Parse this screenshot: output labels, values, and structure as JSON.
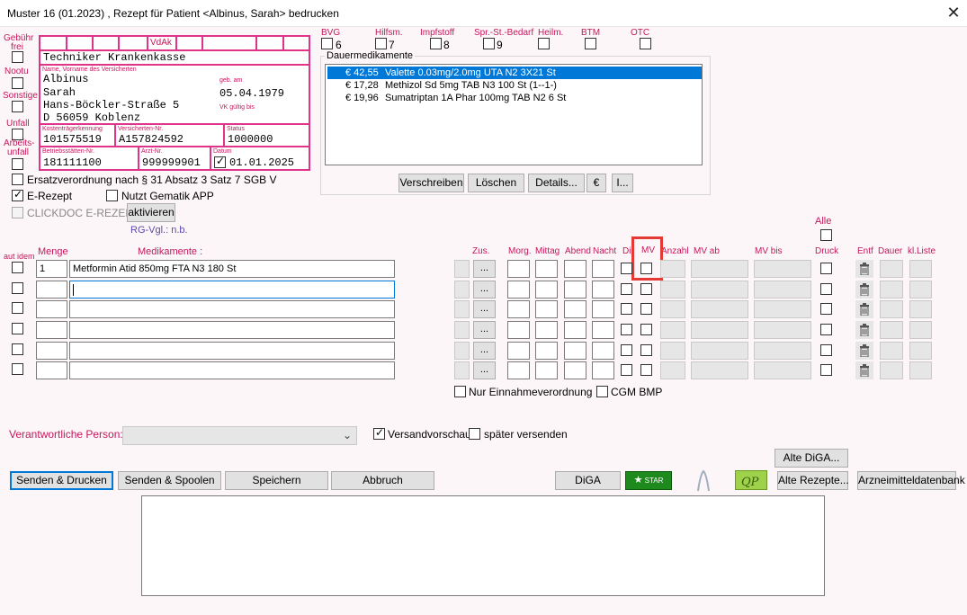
{
  "window": {
    "title": "Muster 16 (01.2023) , Rezept für Patient <Albinus, Sarah> bedrucken",
    "close_glyph": "✕"
  },
  "left_flags": [
    {
      "label": "Gebühr frei",
      "checked": false
    },
    {
      "label": "Nootu",
      "checked": false
    },
    {
      "label": "Sonstige",
      "checked": false
    },
    {
      "label": "Unfall",
      "checked": false
    },
    {
      "label": "Arbeits-unfall",
      "checked": false
    }
  ],
  "form": {
    "vdak_label": "VdAk",
    "kasse": "Techniker Krankenkasse",
    "name_label": "Name, Vorname des Versicherten",
    "last_name": "Albinus",
    "first_name": "Sarah",
    "street": "Hans-Böckler-Straße 5",
    "city": "D 56059 Koblenz",
    "geb_label": "geb. am",
    "birth_date": "05.04.1979",
    "vk_label": "VK gültig bis",
    "kostentraeger_label": "Kostenträgerkennung",
    "kostentraeger": "101575519",
    "versicherten_label": "Versicherten-Nr.",
    "versicherten_nr": "A157824592",
    "status_label": "Status",
    "status": "1000000",
    "betrieb_label": "Betriebsstätten-Nr.",
    "betrieb_nr": "181111100",
    "arzt_label": "Arzt-Nr.",
    "arzt_nr": "999999901",
    "datum_label": "Datum",
    "datum": "01.01.2025"
  },
  "top_flags": [
    {
      "label": "BVG",
      "num": "6"
    },
    {
      "label": "Hilfsm.",
      "num": "7"
    },
    {
      "label": "Impfstoff",
      "num": "8"
    },
    {
      "label": "Spr.-St.-Bedarf",
      "num": "9"
    },
    {
      "label": "Heilm.",
      "num": ""
    },
    {
      "label": "BTM",
      "num": ""
    },
    {
      "label": "OTC",
      "num": ""
    }
  ],
  "dauer": {
    "label": "Dauermedikamente",
    "items": [
      {
        "price": "€ 42,55",
        "name": "Valette 0.03mg/2.0mg UTA N2 3X21 St",
        "selected": true
      },
      {
        "price": "€ 17,28",
        "name": "Methizol Sd 5mg TAB N3 100 St (1--1-)",
        "selected": false
      },
      {
        "price": "€ 19,96",
        "name": "Sumatriptan 1A Phar 100mg TAB N2 6 St",
        "selected": false
      }
    ],
    "buttons": [
      "Verschreiben",
      "Löschen",
      "Details...",
      "€",
      "I..."
    ]
  },
  "options": {
    "ersatz": "Ersatzverordnung nach § 31 Absatz 3 Satz 7 SGB V",
    "erezept": "E-Rezept",
    "gematik": "Nutzt Gematik APP",
    "clickdoc": "CLICKDOC E-REZEPT",
    "aktivieren": "aktivieren",
    "rg_vgl": "RG-Vgl.: n.b.",
    "alle": "Alle"
  },
  "table": {
    "headers": {
      "autidem": "aut idem",
      "menge": "Menge",
      "medikamente": "Medikamente :",
      "zus": "Zus.",
      "morg": "Morg.",
      "mittag": "Mittag",
      "abend": "Abend",
      "nacht": "Nacht",
      "di": "Di",
      "mv": "MV",
      "anzahl": "Anzahl",
      "mvab": "MV ab",
      "mvbis": "MV bis",
      "druck": "Druck",
      "entf": "Entf",
      "dauer": "Dauer",
      "klliste": "kl.Liste"
    },
    "ellipsis": "...",
    "rows": [
      {
        "menge": "1",
        "medikament": "Metformin Atid 850mg FTA N3 180 St"
      },
      {
        "menge": "",
        "medikament": ""
      },
      {
        "menge": "",
        "medikament": ""
      },
      {
        "menge": "",
        "medikament": ""
      },
      {
        "menge": "",
        "medikament": ""
      },
      {
        "menge": "",
        "medikament": ""
      }
    ]
  },
  "bottom": {
    "einnahme": "Nur Einnahmeverordnung",
    "cgm": "CGM BMP",
    "verantwortlich_label": "Verantwortliche Person:",
    "verantwortlich_value": "",
    "versandvorschau": "Versandvorschau",
    "spaeter": "später versenden",
    "alte_diga": "Alte DiGA...",
    "senden_drucken": "Senden & Drucken",
    "senden_spoolen": "Senden & Spoolen",
    "speichern": "Speichern",
    "abbruch": "Abbruch",
    "diga": "DiGA",
    "star": "STAR",
    "alte_rezepte": "Alte Rezepte...",
    "arzneimittel": "Arzneimitteldatenbank",
    "notes": ""
  },
  "colors": {
    "accent": "#e0338a",
    "label_pink": "#c2185b",
    "selection": "#0078d7",
    "highlight": "#e53935"
  }
}
